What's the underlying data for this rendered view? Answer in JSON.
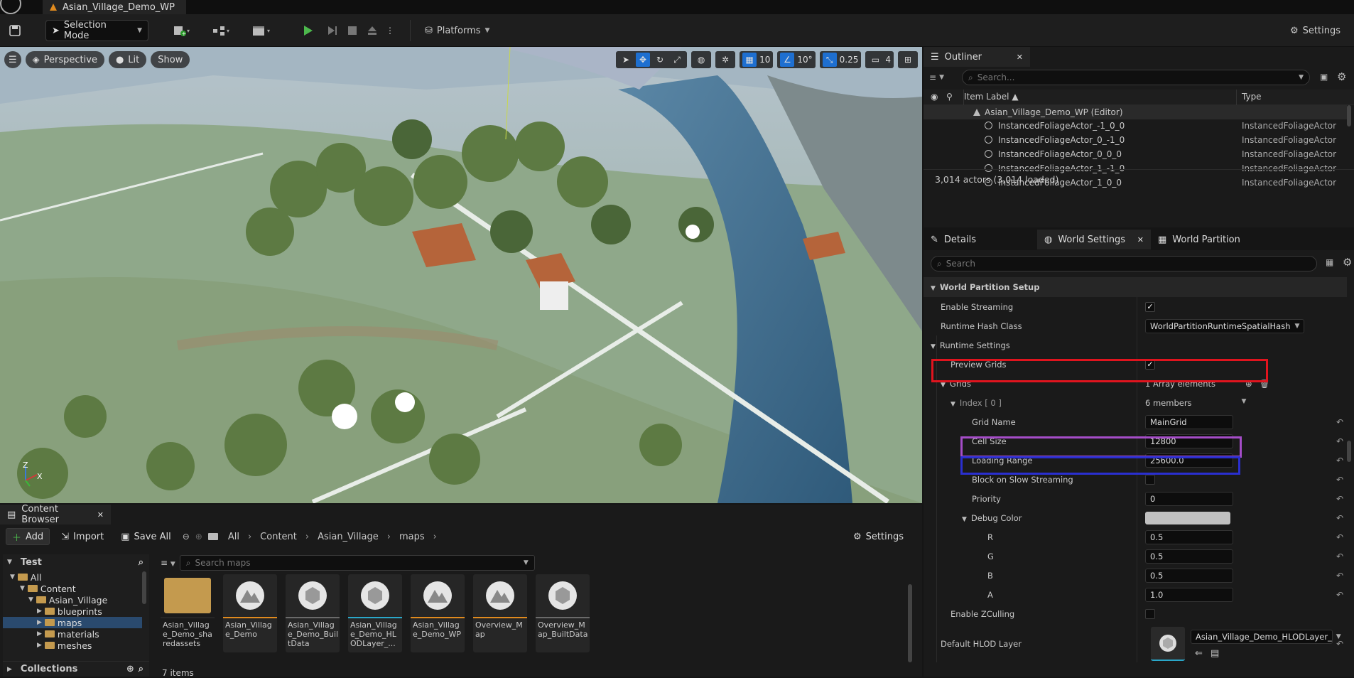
{
  "app": {
    "doc_tab": "Asian_Village_Demo_WP"
  },
  "toolbar": {
    "selection_mode": "Selection Mode",
    "platforms": "Platforms",
    "settings": "Settings"
  },
  "viewport": {
    "perspective": "Perspective",
    "lit": "Lit",
    "show": "Show",
    "grid_snap": "10",
    "rot_snap": "10°",
    "scale_snap": "0.25",
    "cam_speed": "4",
    "axis_x": "X",
    "axis_z": "Z"
  },
  "outliner": {
    "title": "Outliner",
    "search_placeholder": "Search...",
    "col_label": "Item Label",
    "col_type": "Type",
    "root": "Asian_Village_Demo_WP (Editor)",
    "items": [
      {
        "label": "InstancedFoliageActor_-1_0_0",
        "type": "InstancedFoliageActor"
      },
      {
        "label": "InstancedFoliageActor_0_-1_0",
        "type": "InstancedFoliageActor"
      },
      {
        "label": "InstancedFoliageActor_0_0_0",
        "type": "InstancedFoliageActor"
      },
      {
        "label": "InstancedFoliageActor_1_-1_0",
        "type": "InstancedFoliageActor"
      },
      {
        "label": "InstancedFoliageActor_1_0_0",
        "type": "InstancedFoliageActor"
      }
    ],
    "status": "3,014 actors (3,014 loaded)"
  },
  "details": {
    "tab_details": "Details",
    "tab_world_settings": "World Settings",
    "tab_world_partition": "World Partition",
    "search_placeholder": "Search",
    "section_wp_setup": "World Partition Setup",
    "enable_streaming": "Enable Streaming",
    "runtime_hash_class": "Runtime Hash Class",
    "runtime_hash_value": "WorldPartitionRuntimeSpatialHash",
    "runtime_settings": "Runtime Settings",
    "preview_grids": "Preview Grids",
    "grids": "Grids",
    "grids_value": "1 Array elements",
    "index": "Index [ 0 ]",
    "index_value": "6 members",
    "grid_name": "Grid Name",
    "grid_name_value": "MainGrid",
    "cell_size": "Cell Size",
    "cell_size_value": "12800",
    "loading_range": "Loading Range",
    "loading_range_value": "25600.0",
    "block_slow": "Block on Slow Streaming",
    "priority": "Priority",
    "priority_value": "0",
    "debug_color": "Debug Color",
    "r": "R",
    "r_value": "0.5",
    "g": "G",
    "g_value": "0.5",
    "b": "B",
    "b_value": "0.5",
    "a": "A",
    "a_value": "1.0",
    "enable_zculling": "Enable ZCulling",
    "default_hlod": "Default HLOD Layer",
    "default_hlod_value": "Asian_Village_Demo_HLODLayer_"
  },
  "content_browser": {
    "tab": "Content Browser",
    "add": "Add",
    "import": "Import",
    "save_all": "Save All",
    "breadcrumb": [
      "All",
      "Content",
      "Asian_Village",
      "maps"
    ],
    "settings": "Settings",
    "tree_title": "Test",
    "tree": [
      "All",
      "Content",
      "Asian_Village",
      "blueprints",
      "maps",
      "materials",
      "meshes"
    ],
    "collections": "Collections",
    "search_placeholder": "Search maps",
    "items_count": "7 items",
    "assets": [
      {
        "name": "Asian_Village_Demo_sharedassets",
        "kind": "folder",
        "accent": "#262626"
      },
      {
        "name": "Asian_Village_Demo",
        "kind": "map",
        "accent": "#e08a1e"
      },
      {
        "name": "Asian_Village_Demo_BuiltData",
        "kind": "data",
        "accent": "#6a6a6a"
      },
      {
        "name": "Asian_Village_Demo_HLODLayer_...",
        "kind": "data",
        "accent": "#2aa7c9"
      },
      {
        "name": "Asian_Village_Demo_WP",
        "kind": "map",
        "accent": "#e08a1e"
      },
      {
        "name": "Overview_Map",
        "kind": "map",
        "accent": "#e08a1e"
      },
      {
        "name": "Overview_Map_BuiltData",
        "kind": "data",
        "accent": "#6a6a6a"
      }
    ]
  },
  "colors": {
    "highlight_red": "#e0141e",
    "highlight_purple": "#a54dc8",
    "highlight_blue": "#2a2fd0",
    "accent_blue": "#1e6fd0"
  }
}
